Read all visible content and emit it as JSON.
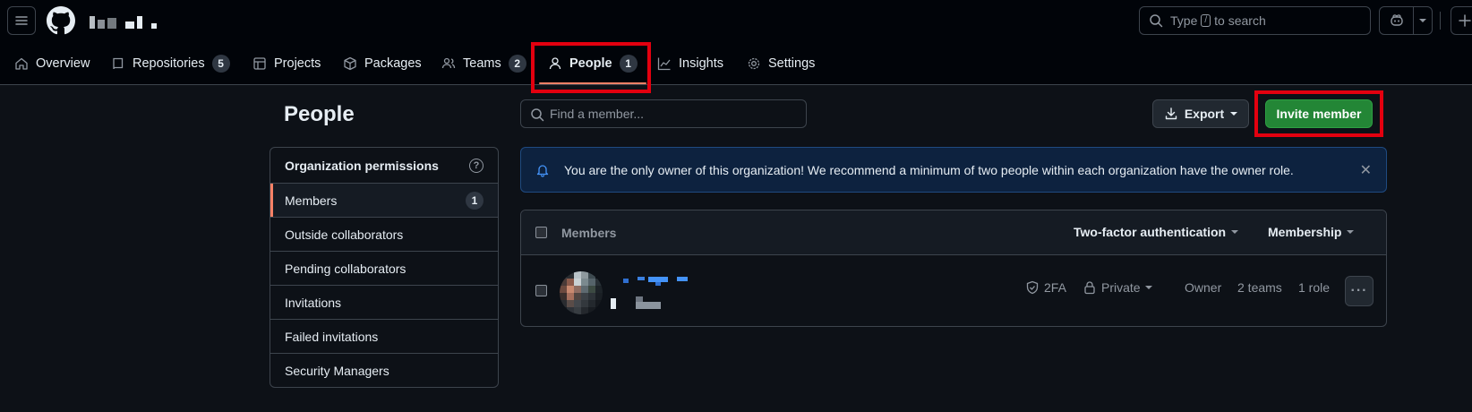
{
  "header": {
    "search_placeholder_pre": "Type",
    "search_key": "/",
    "search_placeholder_post": "to search"
  },
  "nav": {
    "tabs": [
      {
        "label": "Overview",
        "count": ""
      },
      {
        "label": "Repositories",
        "count": "5"
      },
      {
        "label": "Projects",
        "count": ""
      },
      {
        "label": "Packages",
        "count": ""
      },
      {
        "label": "Teams",
        "count": "2"
      },
      {
        "label": "People",
        "count": "1"
      },
      {
        "label": "Insights",
        "count": ""
      },
      {
        "label": "Settings",
        "count": ""
      }
    ],
    "active_tab": "People"
  },
  "page": {
    "title": "People"
  },
  "sidebar": {
    "header": "Organization permissions",
    "items": [
      {
        "label": "Members",
        "count": "1"
      },
      {
        "label": "Outside collaborators"
      },
      {
        "label": "Pending collaborators"
      },
      {
        "label": "Invitations"
      },
      {
        "label": "Failed invitations"
      },
      {
        "label": "Security Managers"
      }
    ]
  },
  "main": {
    "find_placeholder": "Find a member...",
    "export_label": "Export",
    "invite_label": "Invite member",
    "flash_message": "You are the only owner of this organization! We recommend a minimum of two people within each organization have the owner role.",
    "table": {
      "header_label": "Members",
      "filter_2fa": "Two-factor authentication",
      "filter_membership": "Membership",
      "rows": [
        {
          "twofa": "2FA",
          "visibility": "Private",
          "role": "Owner",
          "teams": "2 teams",
          "roles": "1 role"
        }
      ]
    }
  },
  "colors": {
    "accent_underline": "#f78166",
    "invite_green": "#238636",
    "highlight_red": "#e3000f",
    "flash_bg": "#0d223f"
  }
}
